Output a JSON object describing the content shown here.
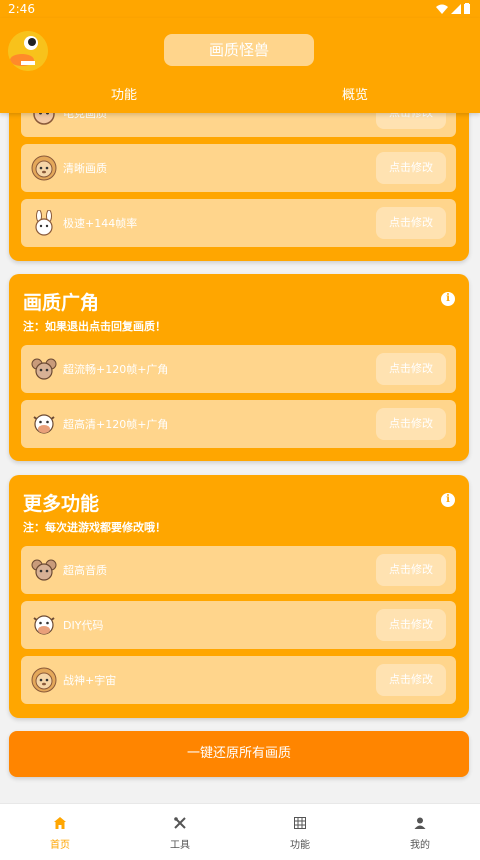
{
  "status": {
    "time": "2:46"
  },
  "header": {
    "title": "画质怪兽",
    "tabs": [
      "功能",
      "概览"
    ]
  },
  "cards": [
    {
      "rows": [
        {
          "label": "电竞画质",
          "icon": "cat-icon",
          "button": "点击修改"
        },
        {
          "label": "清晰画质",
          "icon": "lion-icon",
          "button": "点击修改"
        },
        {
          "label": "极速+144帧率",
          "icon": "rabbit-icon",
          "button": "点击修改"
        }
      ]
    },
    {
      "title": "画质广角",
      "note": "注：如果退出点击回复画质！",
      "rows": [
        {
          "label": "超流畅+120帧+广角",
          "icon": "mouse-icon",
          "button": "点击修改"
        },
        {
          "label": "超高清+120帧+广角",
          "icon": "cow-icon",
          "button": "点击修改"
        }
      ]
    },
    {
      "title": "更多功能",
      "note": "注：每次进游戏都要修改哦！",
      "rows": [
        {
          "label": "超高音质",
          "icon": "mouse-icon",
          "button": "点击修改"
        },
        {
          "label": "DIY代码",
          "icon": "cow-icon",
          "button": "点击修改"
        },
        {
          "label": "战神+宇宙",
          "icon": "lion-icon",
          "button": "点击修改"
        }
      ]
    }
  ],
  "restore_label": "一键还原所有画质",
  "nav": [
    {
      "label": "首页",
      "icon": "home-icon",
      "active": true
    },
    {
      "label": "工具",
      "icon": "tools-icon",
      "active": false
    },
    {
      "label": "功能",
      "icon": "grid-icon",
      "active": false
    },
    {
      "label": "我的",
      "icon": "person-icon",
      "active": false
    }
  ],
  "colors": {
    "primary": "#ffa600",
    "row_bg": "#ffd58c",
    "restore_button": "#ff8500",
    "nav_active": "#ffa600"
  }
}
